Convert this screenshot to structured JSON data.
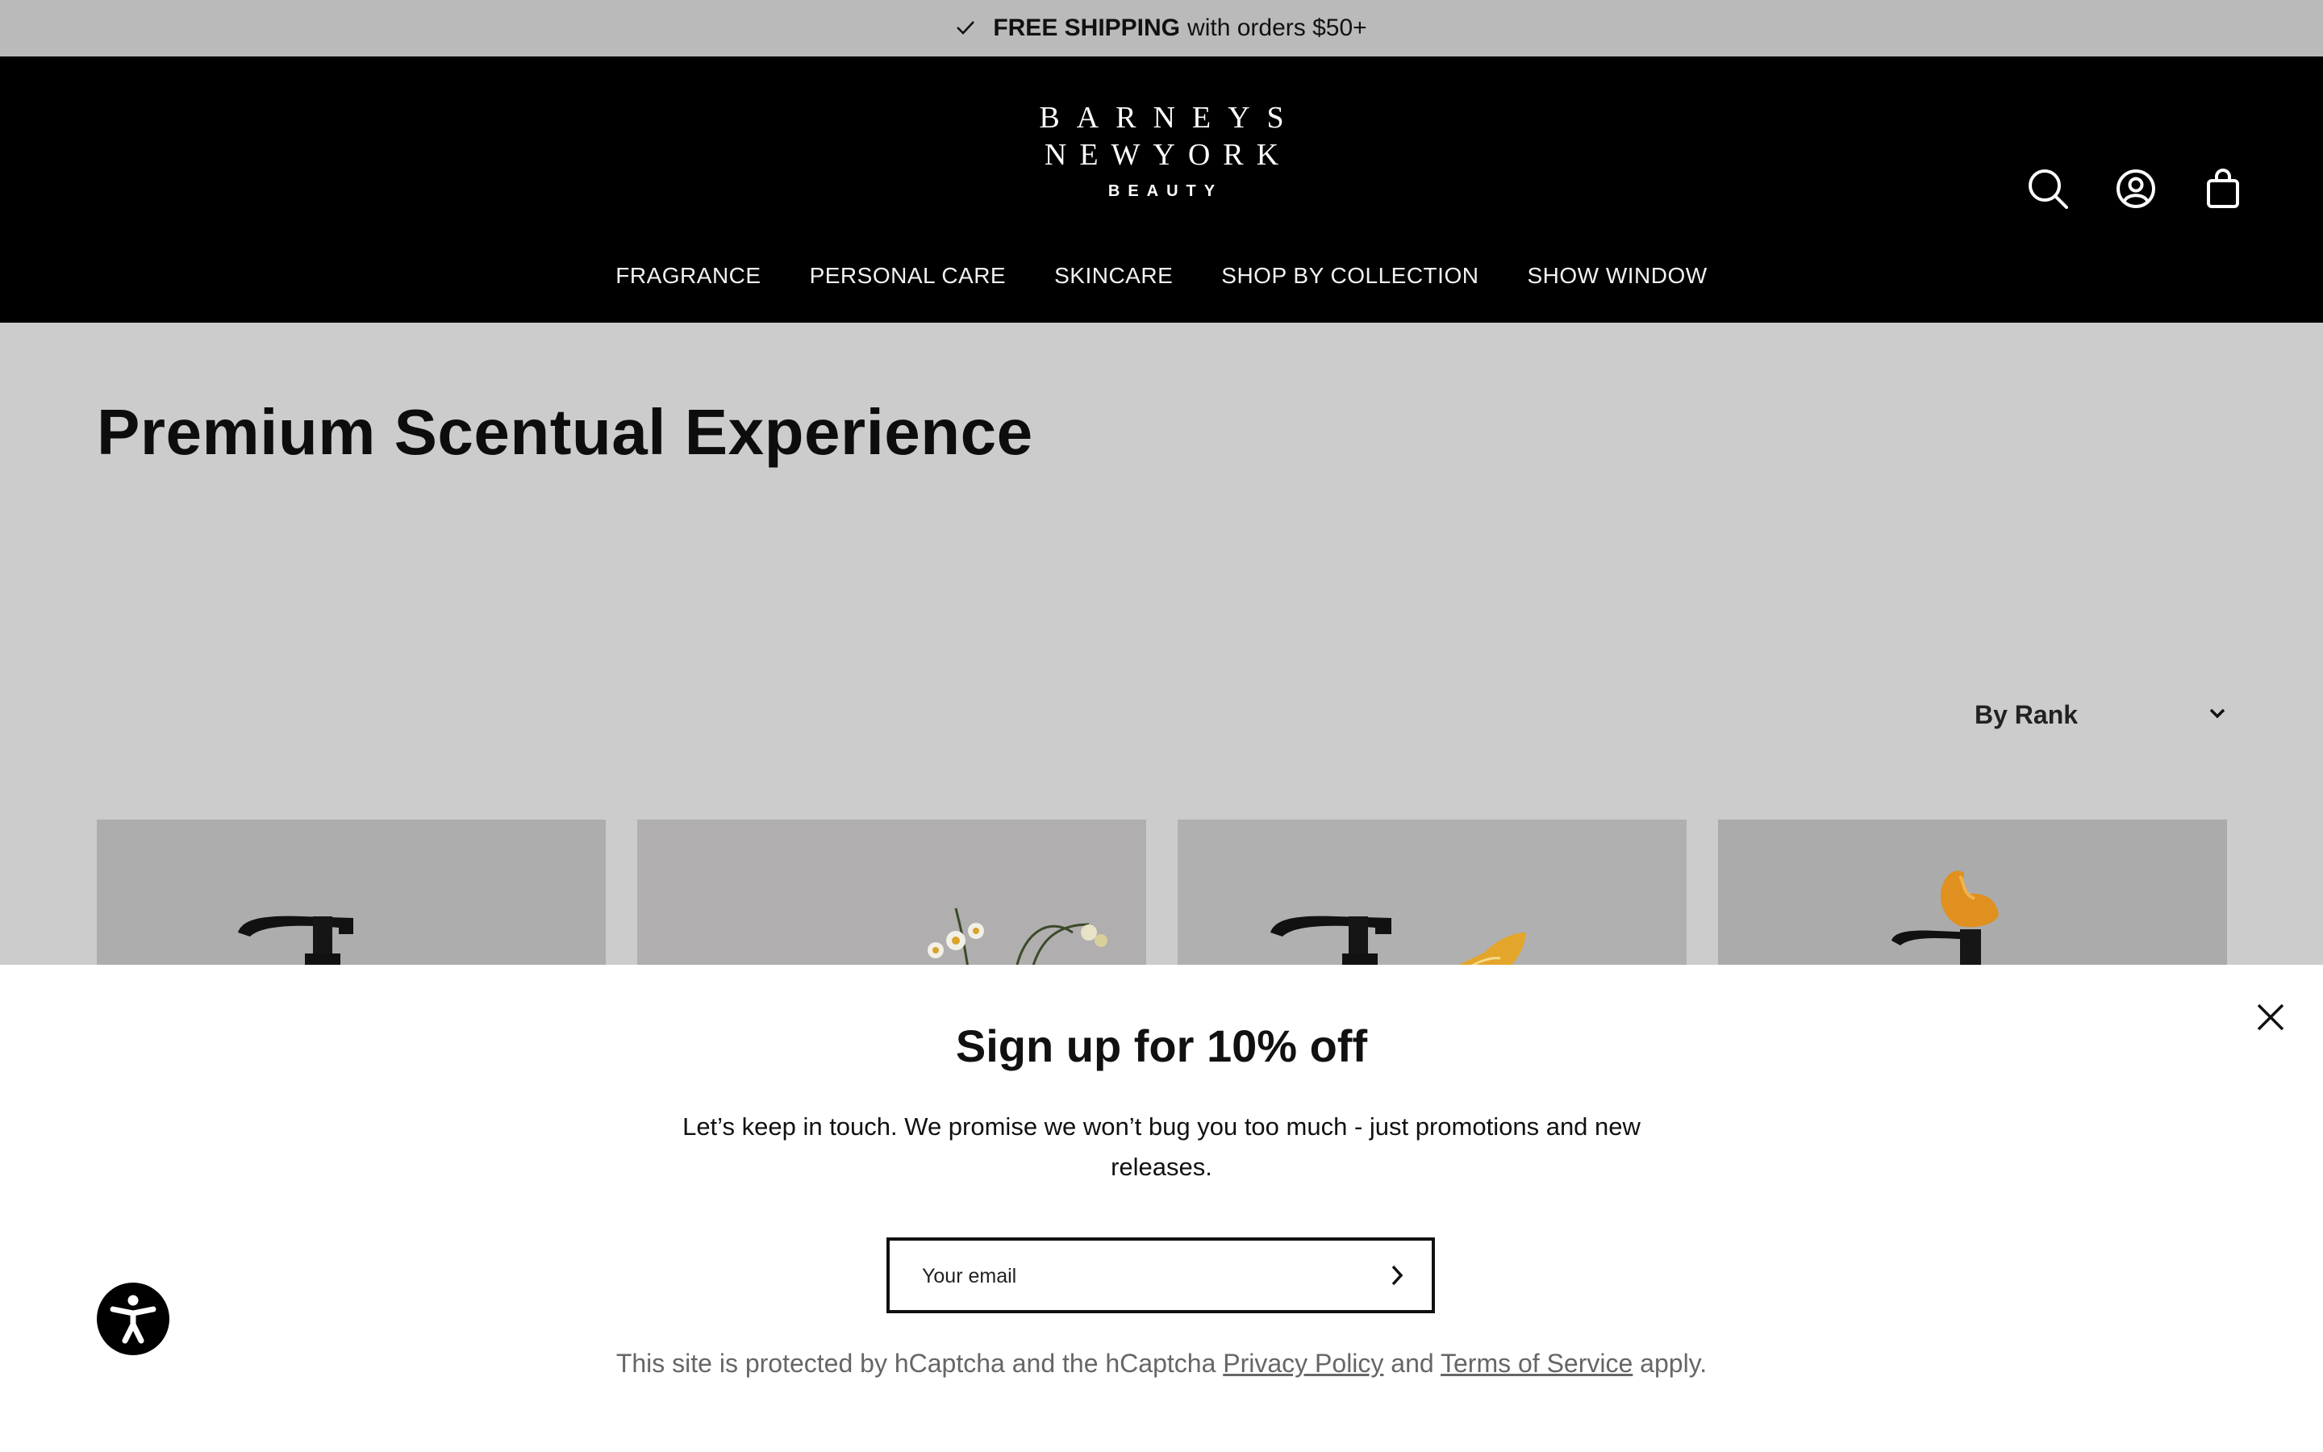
{
  "announcement": {
    "icon": "check-icon",
    "bold": "FREE SHIPPING",
    "text": "with orders $50+"
  },
  "header": {
    "logo": {
      "line1": "BARNEYS",
      "line2": "NEWYORK",
      "line3": "BEAUTY"
    },
    "icons": [
      "search-icon",
      "account-icon",
      "cart-icon"
    ],
    "nav": [
      "FRAGRANCE",
      "PERSONAL CARE",
      "SKINCARE",
      "SHOP BY COLLECTION",
      "SHOW WINDOW"
    ]
  },
  "main": {
    "title": "Premium Scentual Experience",
    "sort": {
      "selected": "By Rank",
      "icon": "chevron-down-icon"
    }
  },
  "popup": {
    "title": "Sign up for 10% off",
    "description": "Let’s keep in touch. We promise we won’t bug you too much - just promotions and new releases.",
    "email_placeholder": "Your email",
    "captcha": {
      "prefix": "This site is protected by hCaptcha and the hCaptcha",
      "privacy": "Privacy Policy",
      "and": "and",
      "terms": "Terms of Service",
      "suffix": "apply."
    }
  },
  "colors": {
    "announcement_bg": "#bababa",
    "header_bg": "#000000",
    "page_bg": "#cccccc",
    "popup_bg": "#ffffff"
  }
}
